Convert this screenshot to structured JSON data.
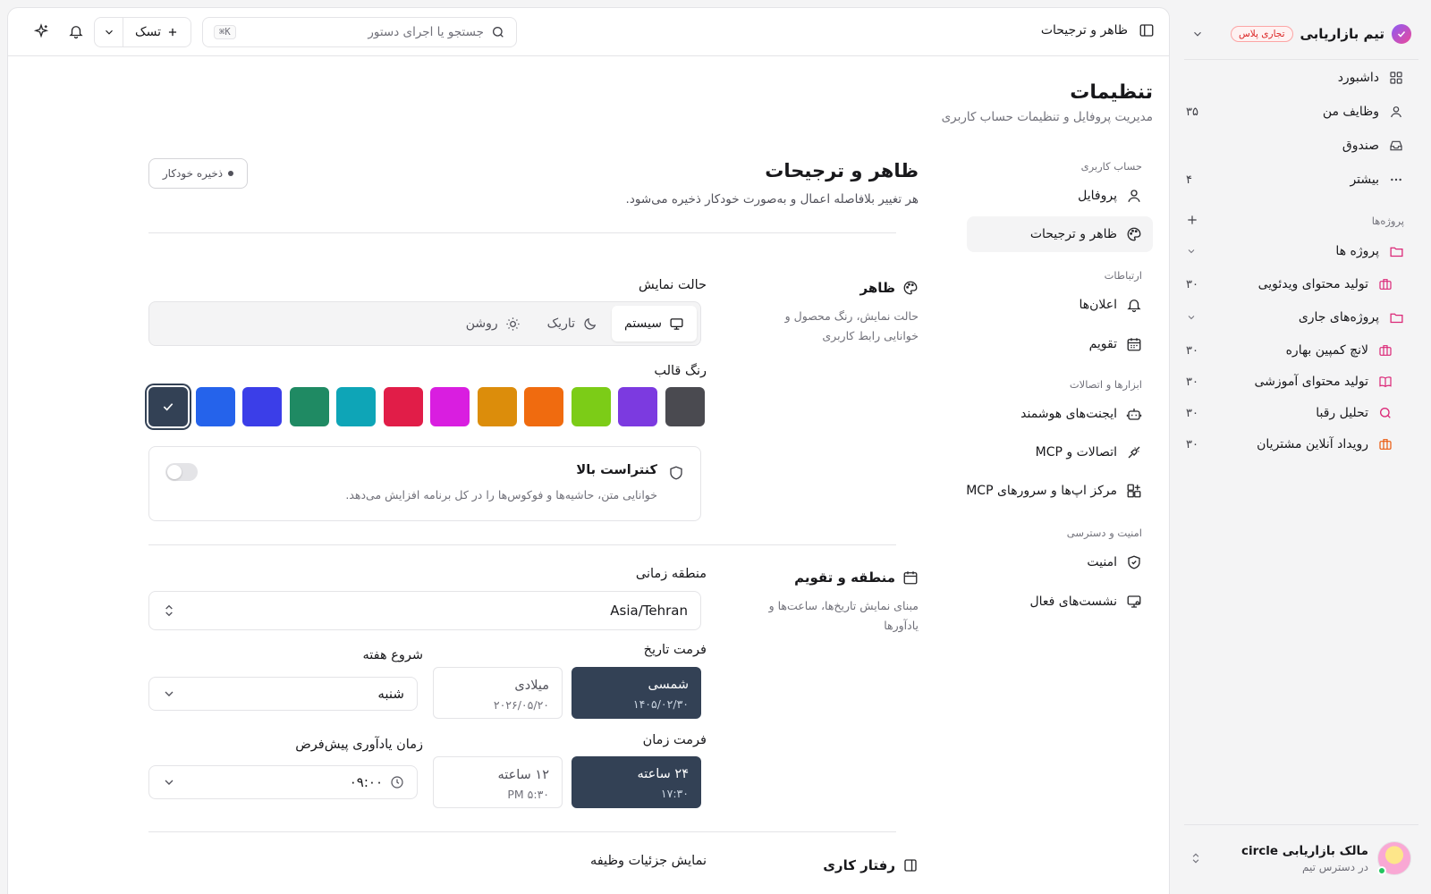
{
  "sidebar": {
    "workspace": {
      "name": "تیم بازاریابی",
      "plan": "تجاری پلاس"
    },
    "nav": [
      {
        "label": "داشبورد",
        "icon": "grid-icon",
        "count": ""
      },
      {
        "label": "وظایف من",
        "icon": "user-icon",
        "count": "۳۵"
      },
      {
        "label": "صندوق",
        "icon": "inbox-icon",
        "count": ""
      },
      {
        "label": "بیشتر",
        "icon": "more-icon",
        "count": "۴"
      }
    ],
    "projects_label": "پروژه‌ها",
    "folders": [
      {
        "label": "پروژه ها",
        "color": "#db2777"
      },
      {
        "label": "پروژه‌های جاری",
        "color": "#db2777"
      }
    ],
    "projects": [
      {
        "label": "تولید محتوای ویدئویی",
        "count": "۳۰",
        "icon": "briefcase-icon",
        "color": "#db2777"
      },
      {
        "label": "لانچ کمپین بهاره",
        "count": "۳۰",
        "icon": "briefcase-icon",
        "color": "#db2777"
      },
      {
        "label": "تولید محتوای آموزشی",
        "count": "۳۰",
        "icon": "book-icon",
        "color": "#db2777"
      },
      {
        "label": "تحلیل رقبا",
        "count": "۳۰",
        "icon": "search-icon",
        "color": "#db2777"
      },
      {
        "label": "رویداد آنلاین مشتریان",
        "count": "۳۰",
        "icon": "briefcase-icon",
        "color": "#ea580c"
      }
    ],
    "user": {
      "name": "مالک بازاریابی circle",
      "subtitle": "در دسترس تیم"
    }
  },
  "topbar": {
    "title": "ظاهر و ترجیحات",
    "search_placeholder": "جستجو یا اجرای دستور",
    "search_shortcut": "⌘K",
    "task_button": "تسک"
  },
  "page": {
    "title": "تنظیمات",
    "subtitle": "مدیریت پروفایل و تنظیمات حساب کاربری"
  },
  "settings_nav": {
    "categories": [
      "حساب کاربری",
      "ارتباطات",
      "ابزارها و اتصالات",
      "امنیت و دسترسی"
    ],
    "items": [
      {
        "label": "پروفایل",
        "icon": "user-icon"
      },
      {
        "label": "ظاهر و ترجیحات",
        "icon": "palette-icon",
        "active": true
      },
      {
        "label": "اعلان‌ها",
        "icon": "bell-icon"
      },
      {
        "label": "تقویم",
        "icon": "calendar-icon"
      },
      {
        "label": "ایجنت‌های هوشمند",
        "icon": "bot-icon"
      },
      {
        "label": "اتصالات و MCP",
        "icon": "plug-icon"
      },
      {
        "label": "مرکز اپ‌ها و سرورهای MCP",
        "icon": "apps-icon"
      },
      {
        "label": "امنیت",
        "icon": "shield-icon"
      },
      {
        "label": "نشست‌های فعال",
        "icon": "monitor-icon"
      }
    ]
  },
  "section": {
    "title": "ظاهر و ترجیحات",
    "subtitle": "هر تغییر بلافاصله اعمال و به‌صورت خودکار ذخیره می‌شود.",
    "autosave": "ذخیره خودکار"
  },
  "appearance": {
    "title": "ظاهر",
    "description": "حالت نمایش، رنگ محصول و خوانایی رابط کاربری",
    "mode_label": "حالت نمایش",
    "modes": [
      {
        "label": "سیستم",
        "icon": "monitor-icon",
        "active": true
      },
      {
        "label": "تاریک",
        "icon": "moon-icon",
        "active": false
      },
      {
        "label": "روشن",
        "icon": "sun-icon",
        "active": false
      }
    ],
    "color_label": "رنگ قالب",
    "colors": [
      "#334155",
      "#2563eb",
      "#3b3ee8",
      "#1f8a63",
      "#0ea5b7",
      "#e11d48",
      "#d91ee0",
      "#dc8d0b",
      "#f06b0f",
      "#7ccc17",
      "#7c3ae0",
      "#4a4a50"
    ],
    "selected_color": 0,
    "contrast_title": "کنتراست بالا",
    "contrast_desc": "خوانایی متن، حاشیه‌ها و فوکوس‌ها را در کل برنامه افزایش می‌دهد.",
    "contrast_on": false
  },
  "region": {
    "title": "منطقه و تقویم",
    "description": "مبنای نمایش تاریخ‌ها، ساعت‌ها و یادآورها",
    "timezone_label": "منطقه زمانی",
    "timezone_value": "Asia/Tehran",
    "date_format_label": "فرمت تاریخ",
    "date_formats": [
      {
        "name": "شمسی",
        "example": "۱۴۰۵/۰۲/۳۰",
        "active": true
      },
      {
        "name": "میلادی",
        "example": "۲۰۲۶/۰۵/۲۰",
        "active": false
      }
    ],
    "week_start_label": "شروع هفته",
    "week_start_value": "شنبه",
    "time_format_label": "فرمت زمان",
    "time_formats": [
      {
        "name": "۲۴ ساعته",
        "example": "۱۷:۳۰",
        "active": true
      },
      {
        "name": "۱۲ ساعته",
        "example": "PM ۵:۳۰",
        "active": false
      }
    ],
    "reminder_label": "زمان یادآوری پیش‌فرض",
    "reminder_value": "۰۹:۰۰"
  },
  "behavior": {
    "title": "رفتار کاری",
    "task_detail_label": "نمایش جزئیات وظیفه"
  }
}
